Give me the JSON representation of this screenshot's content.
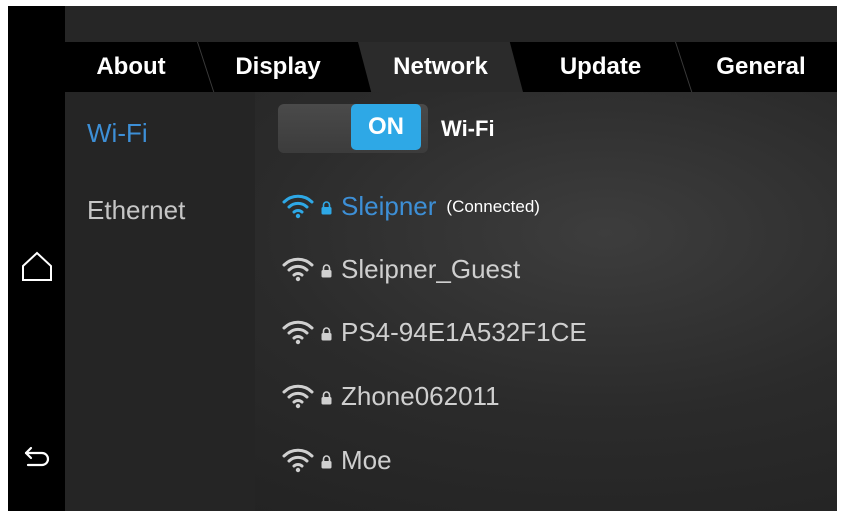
{
  "tabs": [
    {
      "label": "About",
      "active": false
    },
    {
      "label": "Display",
      "active": false
    },
    {
      "label": "Network",
      "active": true
    },
    {
      "label": "Update",
      "active": false
    },
    {
      "label": "General",
      "active": false
    }
  ],
  "sidebar": {
    "items": [
      {
        "label": "Wi-Fi",
        "active": true
      },
      {
        "label": "Ethernet",
        "active": false
      }
    ]
  },
  "wifi": {
    "toggle_state": "ON",
    "toggle_label": "Wi-Fi",
    "networks": [
      {
        "ssid": "Sleipner",
        "status": "(Connected)",
        "secured": true
      },
      {
        "ssid": "Sleipner_Guest",
        "secured": true
      },
      {
        "ssid": "PS4-94E1A532F1CE",
        "secured": true
      },
      {
        "ssid": "Zhone062011",
        "secured": true
      },
      {
        "ssid": "Moe",
        "secured": true
      }
    ]
  },
  "icons": {
    "home": "home-icon",
    "back": "back-arrow-icon",
    "wifi": "wifi-icon",
    "lock": "lock-icon"
  },
  "colors": {
    "accent_blue": "#3d8fd6",
    "toggle_on": "#2ea8e6",
    "background": "#2b2b2b",
    "tab_bar": "#000000",
    "sidebar": "#252525"
  }
}
